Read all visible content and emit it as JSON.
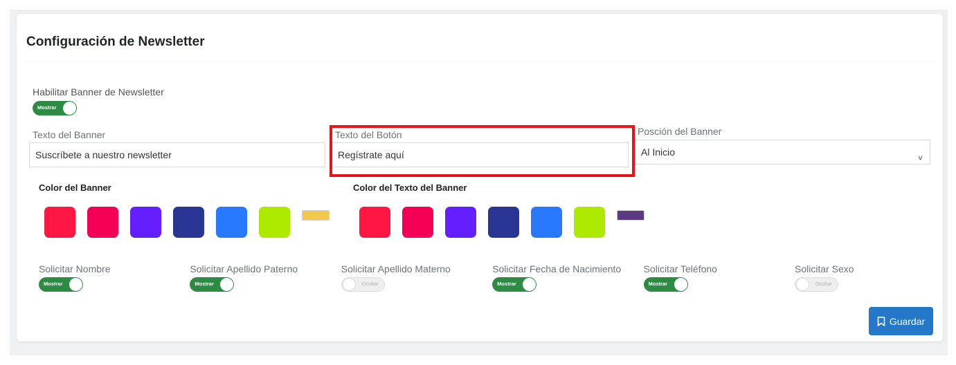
{
  "page": {
    "title": "Configuración de Newsletter"
  },
  "enable_banner": {
    "label": "Habilitar Banner de Newsletter",
    "toggle_text": "Mostrar"
  },
  "banner_text": {
    "label": "Texto del Banner",
    "value": "Suscríbete a nuestro newsletter"
  },
  "button_text": {
    "label": "Texto del Botón",
    "value": "Regístrate aquí"
  },
  "banner_position": {
    "label": "Posción del Banner",
    "value": "Al Inicio"
  },
  "banner_color": {
    "label": "Color del Banner",
    "swatches": [
      "#ff1744",
      "#f50057",
      "#651fff",
      "#283593",
      "#2979ff",
      "#aeea00"
    ],
    "selected": "#f2c94c"
  },
  "banner_text_color": {
    "label": "Color del Texto del Banner",
    "swatches": [
      "#ff1744",
      "#f50057",
      "#651fff",
      "#283593",
      "#2979ff",
      "#aeea00"
    ],
    "selected": "#5b3a84"
  },
  "fields": [
    {
      "label": "Solicitar Nombre",
      "state": "Mostrar",
      "on": true
    },
    {
      "label": "Solicitar Apellido Paterno",
      "state": "Mostrar",
      "on": true
    },
    {
      "label": "Solicitar Apellido Materno",
      "state": "Ocultar",
      "on": false
    },
    {
      "label": "Solicitar Fecha de Nacimiento",
      "state": "Mostrar",
      "on": true
    },
    {
      "label": "Solicitar Teléfono",
      "state": "Mostrar",
      "on": true
    },
    {
      "label": "Solicitar Sexo",
      "state": "Ocultar",
      "on": false
    }
  ],
  "actions": {
    "save_label": "Guardar",
    "save_icon": "bookmark-icon"
  }
}
